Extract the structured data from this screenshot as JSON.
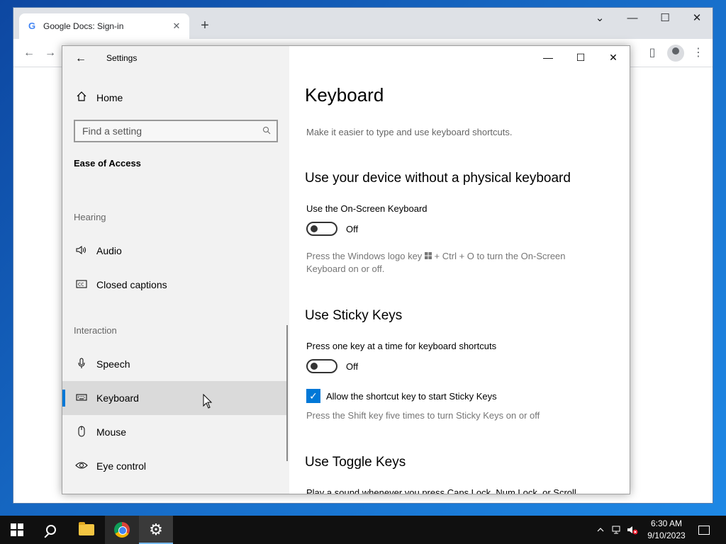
{
  "browser": {
    "tab_title": "Google Docs: Sign-in",
    "tab_favicon": "google-g-icon",
    "new_tab_symbol": "+",
    "controls": {
      "dropdown": "⌄",
      "minimize": "—",
      "maximize": "☐",
      "close": "✕"
    },
    "toolbar": {
      "back": "←",
      "forward": "→",
      "sidebar": "▯",
      "menu": "⋮"
    }
  },
  "settings": {
    "window_title": "Settings",
    "back_symbol": "←",
    "controls": {
      "minimize": "—",
      "maximize": "☐",
      "close": "✕"
    },
    "sidebar": {
      "home": {
        "icon": "home-icon",
        "label": "Home"
      },
      "search": {
        "placeholder": "Find a setting",
        "icon": "search-icon"
      },
      "section_title": "Ease of Access",
      "groups": [
        {
          "header": "Hearing",
          "items": [
            {
              "icon": "speaker-icon",
              "label": "Audio",
              "selected": false
            },
            {
              "icon": "closed-captions-icon",
              "label": "Closed captions",
              "selected": false
            }
          ]
        },
        {
          "header": "Interaction",
          "items": [
            {
              "icon": "microphone-icon",
              "label": "Speech",
              "selected": false
            },
            {
              "icon": "keyboard-icon",
              "label": "Keyboard",
              "selected": true
            },
            {
              "icon": "mouse-icon",
              "label": "Mouse",
              "selected": false
            },
            {
              "icon": "eye-icon",
              "label": "Eye control",
              "selected": false
            }
          ]
        }
      ]
    },
    "content": {
      "title": "Keyboard",
      "subtitle": "Make it easier to type and use keyboard shortcuts.",
      "sections": [
        {
          "heading": "Use your device without a physical keyboard",
          "label": "Use the On-Screen Keyboard",
          "toggle_state": "Off",
          "description_pre": "Press the Windows logo key",
          "description_post": "+ Ctrl + O to turn the On-Screen Keyboard on or off."
        },
        {
          "heading": "Use Sticky Keys",
          "label": "Press one key at a time for keyboard shortcuts",
          "toggle_state": "Off",
          "checkbox_label": "Allow the shortcut key to start Sticky Keys",
          "checkbox_checked": true,
          "description": "Press the Shift key five times to turn Sticky Keys on or off"
        },
        {
          "heading": "Use Toggle Keys",
          "label": "Play a sound whenever you press Caps Lock, Num Lock, or Scroll"
        }
      ]
    }
  },
  "taskbar": {
    "items": [
      {
        "icon": "windows-start-icon",
        "active": false
      },
      {
        "icon": "search-icon",
        "active": false
      },
      {
        "icon": "file-explorer-icon",
        "active": false
      },
      {
        "icon": "chrome-icon",
        "active": false
      },
      {
        "icon": "settings-gear-icon",
        "active": true
      }
    ],
    "tray": {
      "chevron": "^",
      "network_icon": "network-disconnected-icon",
      "volume_icon": "volume-muted-icon"
    },
    "clock": {
      "time": "6:30 AM",
      "date": "9/10/2023"
    }
  },
  "colors": {
    "accent": "#0078d7",
    "taskbar": "#101010",
    "sidebar": "#f2f2f2"
  }
}
